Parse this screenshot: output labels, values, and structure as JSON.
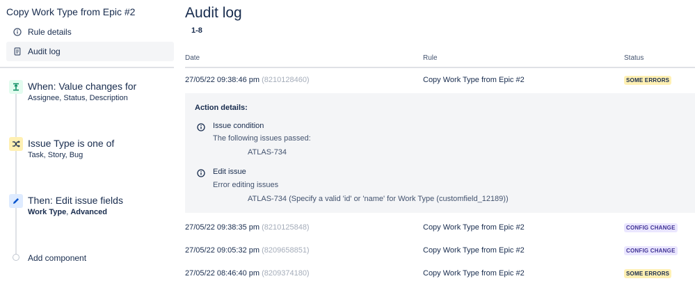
{
  "sidebar": {
    "title": "Copy Work Type from Epic #2",
    "nav": [
      {
        "label": "Rule details",
        "icon": "info-icon",
        "active": false
      },
      {
        "label": "Audit log",
        "icon": "document-icon",
        "active": true
      }
    ],
    "components": [
      {
        "title": "When: Value changes for",
        "subtitle": "Assignee, Status, Description",
        "icon": "trigger-icon",
        "color": "#e3fcef"
      },
      {
        "title": "Issue Type is one of",
        "subtitle": "Task, Story, Bug",
        "icon": "shuffle-icon",
        "color": "#fff0b3"
      },
      {
        "title": "Then: Edit issue fields",
        "subtitle_bold_1": "Work Type",
        "subtitle_sep": ", ",
        "subtitle_bold_2": "Advanced",
        "icon": "pencil-icon",
        "color": "#deebff"
      }
    ],
    "add_component": "Add component"
  },
  "main": {
    "title": "Audit log",
    "range": "1-8",
    "columns": {
      "date": "Date",
      "rule": "Rule",
      "status": "Status"
    },
    "rows": [
      {
        "date": "27/05/22 09:38:46 pm",
        "id": "(8210128460)",
        "rule": "Copy Work Type from Epic #2",
        "status": "SOME ERRORS",
        "status_type": "error"
      },
      {
        "date": "27/05/22 09:38:35 pm",
        "id": "(8210125848)",
        "rule": "Copy Work Type from Epic #2",
        "status": "CONFIG CHANGE",
        "status_type": "config"
      },
      {
        "date": "27/05/22 09:05:32 pm",
        "id": "(8209658851)",
        "rule": "Copy Work Type from Epic #2",
        "status": "CONFIG CHANGE",
        "status_type": "config"
      },
      {
        "date": "27/05/22 08:46:40 pm",
        "id": "(8209374180)",
        "rule": "Copy Work Type from Epic #2",
        "status": "SOME ERRORS",
        "status_type": "error"
      }
    ],
    "details": {
      "heading": "Action details:",
      "actions": [
        {
          "title": "Issue condition",
          "desc": "The following issues passed:",
          "issue": "ATLAS-734"
        },
        {
          "title": "Edit issue",
          "desc": "Error editing issues",
          "issue": "ATLAS-734 (Specify a valid 'id' or 'name' for Work Type (customfield_12189))"
        }
      ]
    }
  }
}
